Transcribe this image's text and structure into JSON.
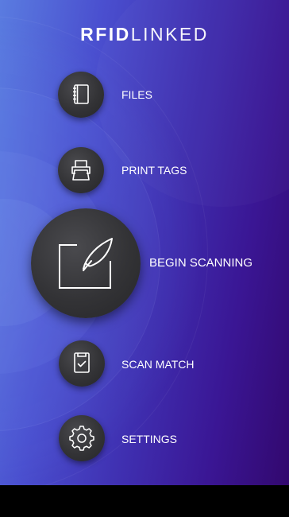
{
  "logo": {
    "bold": "RFID",
    "light": "LINKED"
  },
  "menu": {
    "files": {
      "label": "FILES",
      "icon": "notebook-icon"
    },
    "print_tags": {
      "label": "PRINT TAGS",
      "icon": "printer-icon"
    },
    "begin_scanning": {
      "label": "BEGIN SCANNING",
      "icon": "scan-feather-icon"
    },
    "scan_match": {
      "label": "SCAN MATCH",
      "icon": "clipboard-check-icon"
    },
    "settings": {
      "label": "SETTINGS",
      "icon": "gear-icon"
    }
  },
  "colors": {
    "gradient_start": "#5a7ce0",
    "gradient_end": "#32086e",
    "button": "#333336",
    "text": "#ffffff"
  }
}
